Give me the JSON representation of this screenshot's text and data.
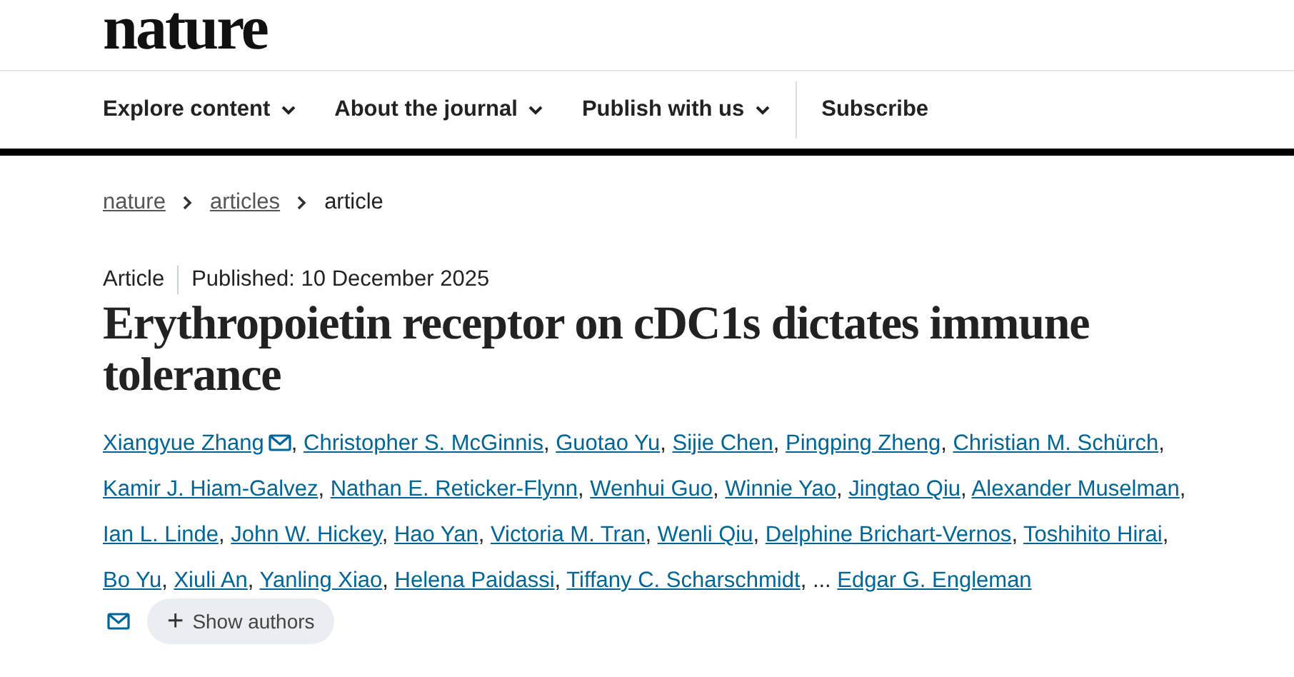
{
  "logo": "nature",
  "nav": [
    {
      "label": "Explore content",
      "dropdown": true
    },
    {
      "label": "About the journal",
      "dropdown": true
    },
    {
      "label": "Publish with us",
      "dropdown": true
    },
    {
      "label": "Subscribe",
      "dropdown": false
    }
  ],
  "breadcrumbs": [
    {
      "label": "nature",
      "link": true
    },
    {
      "label": "articles",
      "link": true
    },
    {
      "label": "article",
      "link": false
    }
  ],
  "article_type": "Article",
  "published": "Published: 10 December 2025",
  "title": "Erythropoietin receptor on cDC1s dictates immune tolerance",
  "authors": [
    {
      "name": "Xiangyue Zhang",
      "email": true,
      "separator": ","
    },
    {
      "name": "Christopher S. McGinnis",
      "email": false,
      "separator": ","
    },
    {
      "name": "Guotao Yu",
      "email": false,
      "separator": ","
    },
    {
      "name": "Sijie Chen",
      "email": false,
      "separator": ","
    },
    {
      "name": "Pingping Zheng",
      "email": false,
      "separator": ","
    },
    {
      "name": "Christian M. Schürch",
      "email": false,
      "separator": ","
    },
    {
      "name": "Kamir J. Hiam-Galvez",
      "email": false,
      "separator": ","
    },
    {
      "name": "Nathan E. Reticker-Flynn",
      "email": false,
      "separator": ","
    },
    {
      "name": "Wenhui Guo",
      "email": false,
      "separator": ","
    },
    {
      "name": "Winnie Yao",
      "email": false,
      "separator": ","
    },
    {
      "name": "Jingtao Qiu",
      "email": false,
      "separator": ","
    },
    {
      "name": "Alexander Muselman",
      "email": false,
      "separator": ","
    },
    {
      "name": "Ian L. Linde",
      "email": false,
      "separator": ","
    },
    {
      "name": "John W. Hickey",
      "email": false,
      "separator": ","
    },
    {
      "name": "Hao Yan",
      "email": false,
      "separator": ","
    },
    {
      "name": "Victoria M. Tran",
      "email": false,
      "separator": ","
    },
    {
      "name": "Wenli Qiu",
      "email": false,
      "separator": ","
    },
    {
      "name": "Delphine Brichart-Vernos",
      "email": false,
      "separator": ","
    },
    {
      "name": "Toshihito Hirai",
      "email": false,
      "separator": ","
    },
    {
      "name": "Bo Yu",
      "email": false,
      "separator": ","
    },
    {
      "name": "Xiuli An",
      "email": false,
      "separator": ","
    },
    {
      "name": "Yanling Xiao",
      "email": false,
      "separator": ","
    },
    {
      "name": "Helena Paidassi",
      "email": false,
      "separator": ","
    },
    {
      "name": "Tiffany C. Scharschmidt",
      "email": false,
      "separator": ","
    }
  ],
  "ellipsis": "...",
  "last_author": {
    "name": "Edgar G. Engleman",
    "email": true
  },
  "show_authors": {
    "icon": "+",
    "label": "Show authors"
  }
}
